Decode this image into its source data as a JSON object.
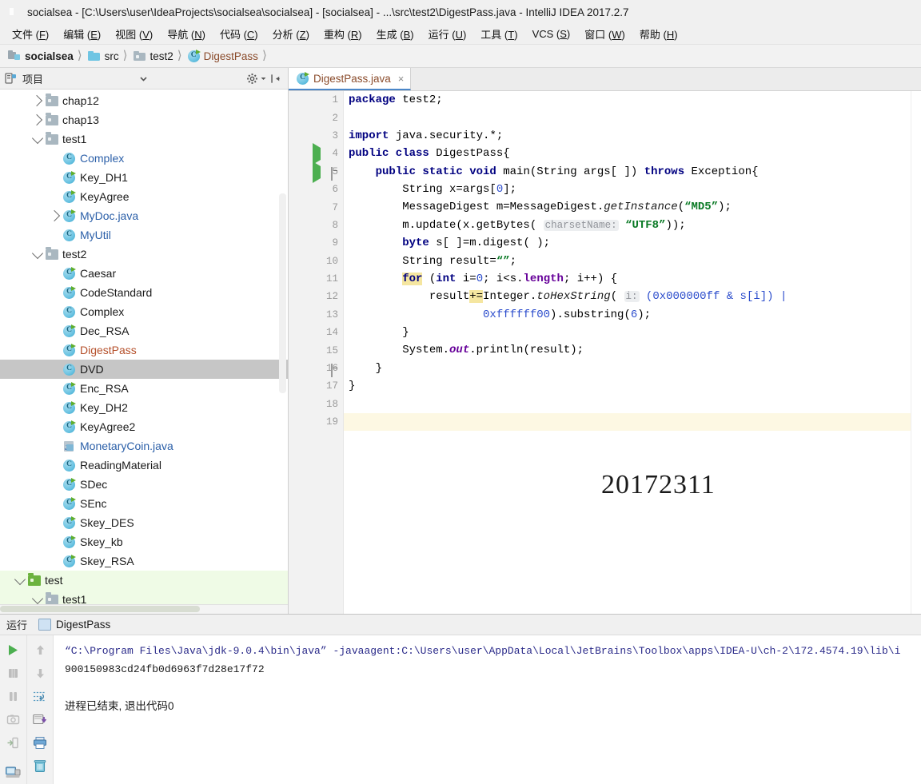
{
  "window": {
    "title": "socialsea - [C:\\Users\\user\\IdeaProjects\\socialsea\\socialsea] - [socialsea] - ...\\src\\test2\\DigestPass.java - IntelliJ IDEA 2017.2.7",
    "app_icon": "intellij-idea-logo"
  },
  "menubar": {
    "items": [
      {
        "label": "文件",
        "mnemonic": "F"
      },
      {
        "label": "编辑",
        "mnemonic": "E"
      },
      {
        "label": "视图",
        "mnemonic": "V"
      },
      {
        "label": "导航",
        "mnemonic": "N"
      },
      {
        "label": "代码",
        "mnemonic": "C"
      },
      {
        "label": "分析",
        "mnemonic": "Z"
      },
      {
        "label": "重构",
        "mnemonic": "R"
      },
      {
        "label": "生成",
        "mnemonic": "B"
      },
      {
        "label": "运行",
        "mnemonic": "U"
      },
      {
        "label": "工具",
        "mnemonic": "T"
      },
      {
        "label": "VCS",
        "mnemonic": "S"
      },
      {
        "label": "窗口",
        "mnemonic": "W"
      },
      {
        "label": "帮助",
        "mnemonic": "H"
      }
    ]
  },
  "breadcrumb": {
    "items": [
      {
        "label": "socialsea",
        "icon": "module-icon",
        "style": "bold"
      },
      {
        "label": "src",
        "icon": "source-folder-icon",
        "style": "normal"
      },
      {
        "label": "test2",
        "icon": "folder-icon",
        "style": "normal"
      },
      {
        "label": "DigestPass",
        "icon": "java-class-icon",
        "style": "file"
      }
    ]
  },
  "project_panel": {
    "title": "项目",
    "icons": {
      "panel": "project-view-icon",
      "dropdown": "chevron-down-icon",
      "settings": "gear-icon",
      "collapse": "hide-panel-icon"
    },
    "tree": [
      {
        "label": "chap12",
        "indent": 1,
        "icon": "folder-icon",
        "arrow": "right",
        "color": "dark",
        "state": "normal"
      },
      {
        "label": "chap13",
        "indent": 1,
        "icon": "folder-icon",
        "arrow": "right",
        "color": "dark",
        "state": "normal"
      },
      {
        "label": "test1",
        "indent": 1,
        "icon": "folder-icon",
        "arrow": "down",
        "color": "dark",
        "state": "normal"
      },
      {
        "label": "Complex",
        "indent": 2,
        "icon": "java-class-icon",
        "arrow": "none",
        "color": "blue",
        "state": "normal"
      },
      {
        "label": "Key_DH1",
        "indent": 2,
        "icon": "java-runnable-icon",
        "arrow": "none",
        "color": "dark",
        "state": "normal"
      },
      {
        "label": "KeyAgree",
        "indent": 2,
        "icon": "java-runnable-icon",
        "arrow": "none",
        "color": "dark",
        "state": "normal"
      },
      {
        "label": "MyDoc.java",
        "indent": 2,
        "icon": "java-runnable-icon",
        "arrow": "right",
        "color": "blue",
        "state": "normal"
      },
      {
        "label": "MyUtil",
        "indent": 2,
        "icon": "java-class-icon",
        "arrow": "none",
        "color": "blue",
        "state": "normal"
      },
      {
        "label": "test2",
        "indent": 1,
        "icon": "folder-icon",
        "arrow": "down",
        "color": "dark",
        "state": "normal"
      },
      {
        "label": "Caesar",
        "indent": 2,
        "icon": "java-runnable-icon",
        "arrow": "none",
        "color": "dark",
        "state": "normal"
      },
      {
        "label": "CodeStandard",
        "indent": 2,
        "icon": "java-runnable-icon",
        "arrow": "none",
        "color": "dark",
        "state": "normal"
      },
      {
        "label": "Complex",
        "indent": 2,
        "icon": "java-class-icon",
        "arrow": "none",
        "color": "dark",
        "state": "normal"
      },
      {
        "label": "Dec_RSA",
        "indent": 2,
        "icon": "java-runnable-icon",
        "arrow": "none",
        "color": "dark",
        "state": "normal"
      },
      {
        "label": "DigestPass",
        "indent": 2,
        "icon": "java-runnable-icon",
        "arrow": "none",
        "color": "orange",
        "state": "open"
      },
      {
        "label": "DVD",
        "indent": 2,
        "icon": "java-class-icon",
        "arrow": "none",
        "color": "dark",
        "state": "selected"
      },
      {
        "label": "Enc_RSA",
        "indent": 2,
        "icon": "java-runnable-icon",
        "arrow": "none",
        "color": "dark",
        "state": "normal"
      },
      {
        "label": "Key_DH2",
        "indent": 2,
        "icon": "java-runnable-icon",
        "arrow": "none",
        "color": "dark",
        "state": "normal"
      },
      {
        "label": "KeyAgree2",
        "indent": 2,
        "icon": "java-runnable-icon",
        "arrow": "none",
        "color": "dark",
        "state": "normal"
      },
      {
        "label": "MonetaryCoin.java",
        "indent": 2,
        "icon": "java-file-icon",
        "arrow": "none",
        "color": "blue",
        "state": "normal"
      },
      {
        "label": "ReadingMaterial",
        "indent": 2,
        "icon": "java-class-icon",
        "arrow": "none",
        "color": "dark",
        "state": "normal"
      },
      {
        "label": "SDec",
        "indent": 2,
        "icon": "java-runnable-icon",
        "arrow": "none",
        "color": "dark",
        "state": "normal"
      },
      {
        "label": "SEnc",
        "indent": 2,
        "icon": "java-runnable-icon",
        "arrow": "none",
        "color": "dark",
        "state": "normal"
      },
      {
        "label": "Skey_DES",
        "indent": 2,
        "icon": "java-runnable-icon",
        "arrow": "none",
        "color": "dark",
        "state": "normal"
      },
      {
        "label": "Skey_kb",
        "indent": 2,
        "icon": "java-runnable-icon",
        "arrow": "none",
        "color": "dark",
        "state": "normal"
      },
      {
        "label": "Skey_RSA",
        "indent": 2,
        "icon": "java-runnable-icon",
        "arrow": "none",
        "color": "dark",
        "state": "normal"
      },
      {
        "label": "test",
        "indent": 0,
        "icon": "test-folder-icon",
        "arrow": "down",
        "color": "dark",
        "state": "testroot"
      },
      {
        "label": "test1",
        "indent": 1,
        "icon": "folder-icon",
        "arrow": "down",
        "color": "dark",
        "state": "testroot"
      }
    ]
  },
  "editor": {
    "tab": {
      "label": "DigestPass.java",
      "icon": "java-runnable-icon",
      "close": "×"
    },
    "watermark": "20172311",
    "caret_line": 19,
    "line_count": 19,
    "gutter_run_markers": [
      4,
      5
    ],
    "gutter_fold_markers": [
      5,
      16
    ],
    "lines": [
      {
        "n": 1,
        "tokens": [
          {
            "t": "package",
            "c": "k"
          },
          {
            "t": " test2;",
            "c": ""
          }
        ]
      },
      {
        "n": 2,
        "tokens": []
      },
      {
        "n": 3,
        "tokens": [
          {
            "t": "import",
            "c": "k"
          },
          {
            "t": " java.security.*;",
            "c": ""
          }
        ]
      },
      {
        "n": 4,
        "tokens": [
          {
            "t": "public class",
            "c": "k"
          },
          {
            "t": " DigestPass{",
            "c": ""
          }
        ]
      },
      {
        "n": 5,
        "tokens": [
          {
            "t": "    ",
            "c": ""
          },
          {
            "t": "public static void",
            "c": "k"
          },
          {
            "t": " main(String args[ ]) ",
            "c": ""
          },
          {
            "t": "throws",
            "c": "k"
          },
          {
            "t": " Exception{",
            "c": ""
          }
        ]
      },
      {
        "n": 6,
        "tokens": [
          {
            "t": "        String x=args[",
            "c": ""
          },
          {
            "t": "0",
            "c": "n"
          },
          {
            "t": "];",
            "c": ""
          }
        ]
      },
      {
        "n": 7,
        "tokens": [
          {
            "t": "        MessageDigest m=MessageDigest.",
            "c": ""
          },
          {
            "t": "getInstance",
            "c": "f"
          },
          {
            "t": "(",
            "c": ""
          },
          {
            "t": "“MD5”",
            "c": "s"
          },
          {
            "t": ");",
            "c": ""
          }
        ]
      },
      {
        "n": 8,
        "tokens": [
          {
            "t": "        m.update(x.getBytes( ",
            "c": ""
          },
          {
            "t": "charsetName:",
            "c": "hint"
          },
          {
            "t": " ",
            "c": ""
          },
          {
            "t": "“UTF8”",
            "c": "s"
          },
          {
            "t": "));",
            "c": ""
          }
        ]
      },
      {
        "n": 9,
        "tokens": [
          {
            "t": "        ",
            "c": ""
          },
          {
            "t": "byte",
            "c": "k"
          },
          {
            "t": " s[ ]=m.digest( );",
            "c": ""
          }
        ]
      },
      {
        "n": 10,
        "tokens": [
          {
            "t": "        String result=",
            "c": ""
          },
          {
            "t": "“”",
            "c": "s"
          },
          {
            "t": ";",
            "c": ""
          }
        ]
      },
      {
        "n": 11,
        "tokens": [
          {
            "t": "        ",
            "c": ""
          },
          {
            "t": "for",
            "c": "k hl"
          },
          {
            "t": " (",
            "c": ""
          },
          {
            "t": "int",
            "c": "k"
          },
          {
            "t": " i=",
            "c": ""
          },
          {
            "t": "0",
            "c": "n"
          },
          {
            "t": "; i<s.",
            "c": ""
          },
          {
            "t": "length",
            "c": "fld"
          },
          {
            "t": "; i++) {",
            "c": ""
          }
        ]
      },
      {
        "n": 12,
        "tokens": [
          {
            "t": "            result",
            "c": ""
          },
          {
            "t": "+=",
            "c": "hl"
          },
          {
            "t": "Integer.",
            "c": ""
          },
          {
            "t": "toHexString",
            "c": "f"
          },
          {
            "t": "( ",
            "c": ""
          },
          {
            "t": "i:",
            "c": "hint"
          },
          {
            "t": " ",
            "c": ""
          },
          {
            "t": "(",
            "c": "n"
          },
          {
            "t": "0x000000ff",
            "c": "n"
          },
          {
            "t": " & s[i]) |",
            "c": "n"
          }
        ]
      },
      {
        "n": 13,
        "tokens": [
          {
            "t": "                    ",
            "c": ""
          },
          {
            "t": "0xffffff00",
            "c": "n"
          },
          {
            "t": ").substring(",
            "c": ""
          },
          {
            "t": "6",
            "c": "n"
          },
          {
            "t": ");",
            "c": ""
          }
        ]
      },
      {
        "n": 14,
        "tokens": [
          {
            "t": "        }",
            "c": ""
          }
        ]
      },
      {
        "n": 15,
        "tokens": [
          {
            "t": "        System.",
            "c": ""
          },
          {
            "t": "out",
            "c": "st"
          },
          {
            "t": ".println(result);",
            "c": ""
          }
        ]
      },
      {
        "n": 16,
        "tokens": [
          {
            "t": "    }",
            "c": ""
          }
        ]
      },
      {
        "n": 17,
        "tokens": [
          {
            "t": "}",
            "c": ""
          }
        ]
      },
      {
        "n": 18,
        "tokens": []
      },
      {
        "n": 19,
        "tokens": []
      }
    ]
  },
  "run_window": {
    "label": "运行",
    "tab_label": "DigestPass",
    "left_tools": [
      {
        "name": "rerun-button",
        "icon": "play-icon",
        "enabled": true
      },
      {
        "name": "stop-button",
        "icon": "stop-icon",
        "enabled": false
      },
      {
        "name": "pause-button",
        "icon": "pause-icon",
        "enabled": false
      },
      {
        "name": "dump-threads-button",
        "icon": "camera-icon",
        "enabled": false
      },
      {
        "name": "exit-button",
        "icon": "exit-icon",
        "enabled": false
      },
      {
        "name": "console-button",
        "icon": "console-icon",
        "enabled": true
      }
    ],
    "right_tools": [
      {
        "name": "scroll-up-button",
        "icon": "arrow-up-icon",
        "enabled": false
      },
      {
        "name": "scroll-down-button",
        "icon": "arrow-down-icon",
        "enabled": false
      },
      {
        "name": "soft-wrap-button",
        "icon": "soft-wrap-icon",
        "enabled": true
      },
      {
        "name": "export-button",
        "icon": "export-icon",
        "enabled": true
      },
      {
        "name": "print-button",
        "icon": "print-icon",
        "enabled": true
      },
      {
        "name": "clear-all-button",
        "icon": "trash-icon",
        "enabled": true
      }
    ],
    "console": {
      "command": "“C:\\Program Files\\Java\\jdk-9.0.4\\bin\\java” -javaagent:C:\\Users\\user\\AppData\\Local\\JetBrains\\Toolbox\\apps\\IDEA-U\\ch-2\\172.4574.19\\lib\\i",
      "output": "900150983cd24fb0d6963f7d28e17f72",
      "exit_message": "进程已结束, 退出代码0"
    }
  },
  "colors": {
    "accent_blue": "#4a86c8",
    "keyword": "#000080",
    "string": "#0a7a25",
    "number": "#2b4ccc",
    "field": "#660099",
    "open_file": "#b5502b",
    "library": "#2b5fa8",
    "test_root": "#6cb33f",
    "caret_line": "#fdf8e3",
    "selection": "#c6c6c6"
  }
}
